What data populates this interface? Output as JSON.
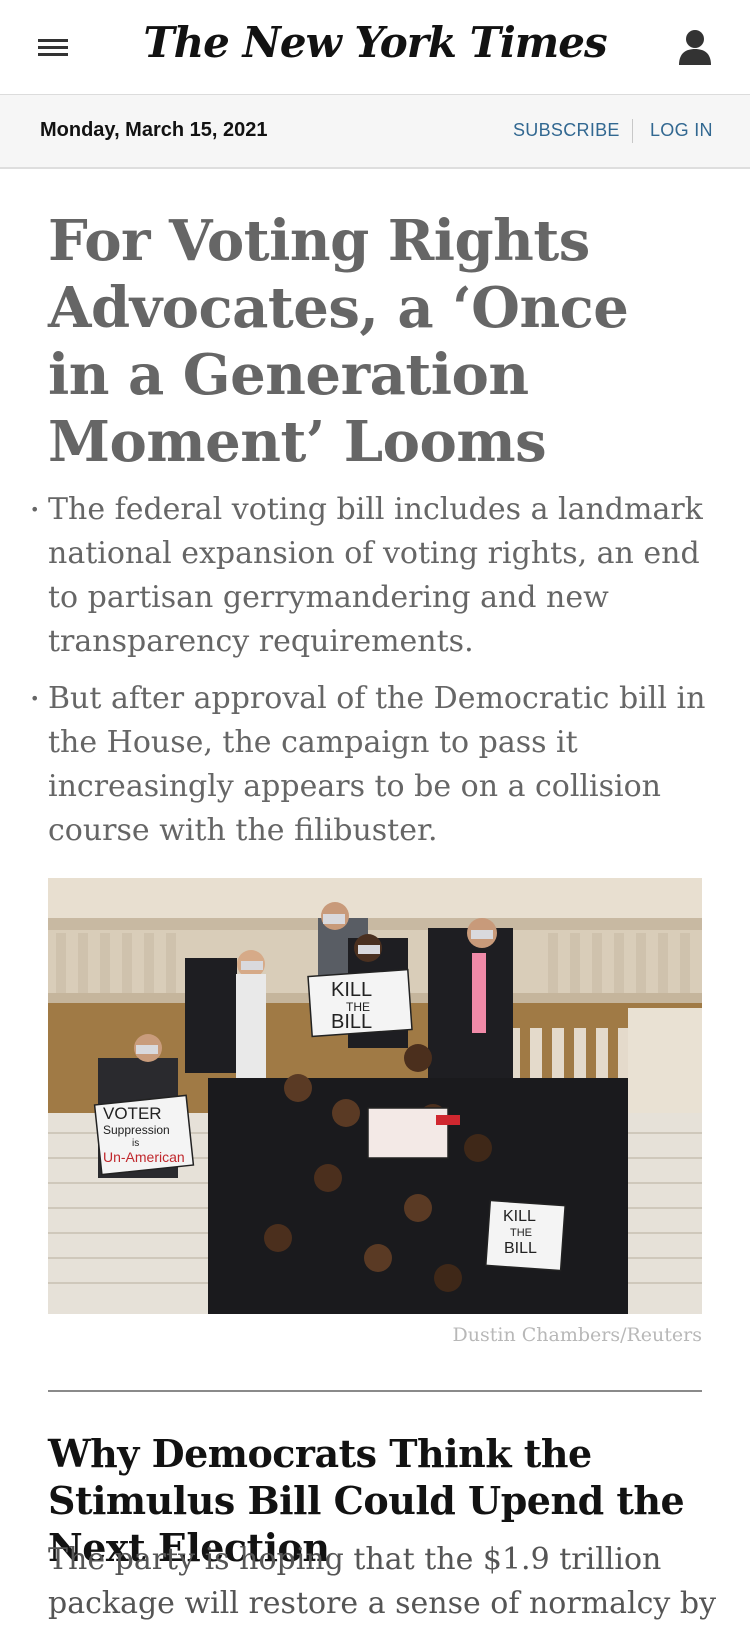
{
  "header": {
    "masthead": "The New York Times",
    "menu_icon": "hamburger-menu-icon",
    "account_icon": "user-account-icon"
  },
  "datebar": {
    "date": "Monday, March 15, 2021",
    "subscribe_label": "SUBSCRIBE",
    "login_label": "LOG IN"
  },
  "lead_story": {
    "headline": "For Voting Rights Advocates, a ‘Once in a Generation Moment’ Looms",
    "summary_points": [
      "The federal voting bill includes a landmark national expansion of voting rights, an end to partisan gerrymandering and new transparency requirements.",
      "But after approval of the Democratic bill in the House, the campaign to pass it increasingly appears to be on a collision course with the filibuster."
    ],
    "photo": {
      "signs": [
        "KILL",
        "THE",
        "BILL",
        "VOTER",
        "Suppression",
        "is",
        "Un-American",
        "KILL",
        "THE",
        "BILL"
      ],
      "credit": "Dustin Chambers/Reuters"
    }
  },
  "second_story": {
    "headline": "Why Democrats Think the Stimulus Bill Could Upend the Next Election",
    "summary": "The party is hoping that the $1.9 trillion package will restore a sense of normalcy by"
  },
  "colors": {
    "link": "#326891",
    "headline_gray": "#666666",
    "datebar_bg": "#f6f6f6"
  }
}
